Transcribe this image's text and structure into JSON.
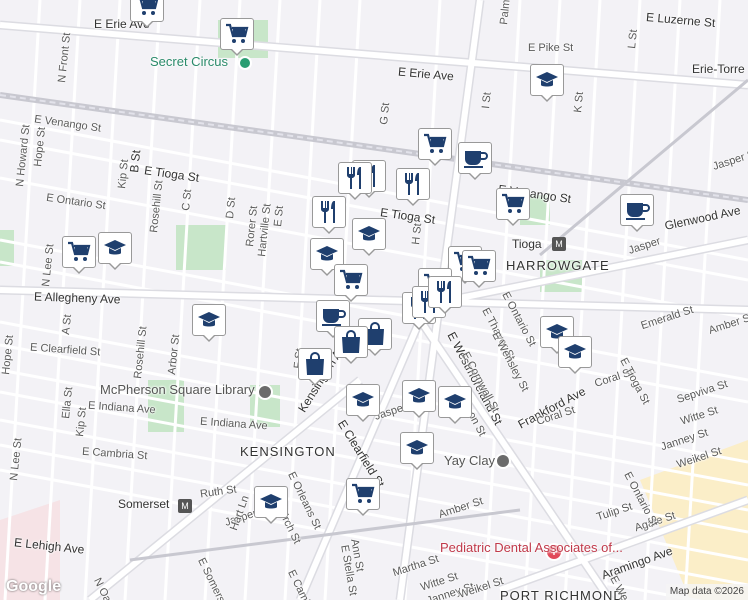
{
  "colors": {
    "background": "#f3f2f6",
    "road": "#ffffff",
    "road_edge": "#dcdce2",
    "park": "#c8e6c9",
    "rail": "#b8b8c0",
    "marker": "#1f3f6e",
    "accent_beige": "#fbeec8"
  },
  "labels": {
    "erie_ave_left": "E Erie Ave",
    "erie_ave_right": "E Erie Ave",
    "luzerne": "E Luzerne St",
    "pike": "E Pike St",
    "erie_torre": "Erie-Torre",
    "palmetto": "Palmetto St",
    "l_st": "L St",
    "k_st": "K St",
    "i_st": "I St",
    "g_st": "G St",
    "e_st_top": "E St",
    "n_front": "N Front St",
    "b_st": "B St",
    "venango_left": "E Venango St",
    "venango_right": "E Venango St",
    "tioga_left": "E Tioga St",
    "tioga_mid": "E Tioga St",
    "tioga_station": "Tioga",
    "ontario_left": "E Ontario St",
    "ontario_right": "E Ontario St",
    "glenwood": "Glenwood Ave",
    "harrowgate": "HARROWGATE",
    "allegheny": "E Allegheny Ave",
    "clearfield_left": "E Clearfield St",
    "clearfield_diag": "E Clearfield St",
    "kensington": "KENSINGTON",
    "kensington_ave": "Kensington Ave",
    "indiana_left": "E Indiana Ave",
    "indiana_mid": "E Indiana Ave",
    "cambria": "E Cambria St",
    "lehigh": "E Lehigh Ave",
    "somerset": "Somerset",
    "mcpherson": "McPherson Square Library",
    "secret_circus": "Secret Circus",
    "yay_clay": "Yay Clay",
    "pediatric": "Pediatric Dental Associates of...",
    "port_richmond": "PORT RICHMOND",
    "frankford": "Frankford Ave",
    "westmoreland": "E Westmoreland St",
    "aramingo": "Aramingo Ave",
    "emerald": "Emerald St",
    "amber_right": "Amber St",
    "amber_bottom": "Amber St",
    "coral_right": "Coral St",
    "coral_mid": "Coral St",
    "jasper_right": "Jasper St",
    "jasper_far": "Jasper",
    "jasper_mid": "Jasper",
    "jasper_bottom": "Jasper St",
    "janney": "Janney St",
    "janney_bottom": "Janney St",
    "weikel": "Weikel St",
    "weikel_bottom": "Weikel St",
    "witte": "Witte St",
    "witte_bottom": "Witte St",
    "sepviva": "Sepviva St",
    "tulip": "Tulip St",
    "agate": "Agate St",
    "martha": "Martha St",
    "ruth": "Ruth St",
    "hart": "Hart Ln",
    "orleans": "E Orleans St",
    "birch": "Birch St",
    "ann": "Ann St",
    "e_stella": "E Stella St",
    "cornwall": "E Cornwall St",
    "thayer": "E Thayer St",
    "wensley": "E Wensley St",
    "ontario_diag": "E Ontario St",
    "tioga_diag": "E Tioga St",
    "ontario_low": "E Ontario St",
    "rorer": "Rorer St",
    "hartville": "Hartville St",
    "d_st": "D St",
    "c_st": "C St",
    "kip_top": "Kip St",
    "kip_mid": "Kip St",
    "rosehill_top": "Rosehill St",
    "rosehill_mid": "Rosehill St",
    "arbor": "Arbor St",
    "ella": "Ella St",
    "a_st": "A St",
    "hope_top": "Hope St",
    "hope_mid": "Hope St",
    "howard": "N Howard St",
    "n_lee_top": "N Lee St",
    "n_lee_bot": "N Lee St",
    "h_st": "H St",
    "f_st": "F St",
    "e_st_mid": "E St",
    "somerset_e": "E Somers",
    "camb_e": "E Camb",
    "oak": "N Oak",
    "on_st": "on St",
    "e_west": "E West",
    "attribution": "Map data ©2026"
  },
  "pins": [
    {
      "name": "shopping-cart-icon",
      "type": "cart"
    },
    {
      "name": "shopping-cart-icon",
      "type": "cart"
    },
    {
      "name": "school-icon",
      "type": "school"
    },
    {
      "name": "shopping-cart-icon",
      "type": "cart"
    },
    {
      "name": "cafe-icon",
      "type": "cafe"
    },
    {
      "name": "restaurant-icon",
      "type": "food"
    },
    {
      "name": "restaurant-icon",
      "type": "food"
    },
    {
      "name": "restaurant-icon",
      "type": "food"
    },
    {
      "name": "restaurant-icon",
      "type": "food"
    },
    {
      "name": "school-icon",
      "type": "school"
    },
    {
      "name": "school-icon",
      "type": "school"
    },
    {
      "name": "shopping-cart-icon",
      "type": "cart"
    },
    {
      "name": "shopping-cart-icon",
      "type": "cart"
    },
    {
      "name": "shopping-cart-icon",
      "type": "cart"
    },
    {
      "name": "cafe-icon",
      "type": "cafe"
    },
    {
      "name": "school-icon",
      "type": "school"
    },
    {
      "name": "shopping-cart-icon",
      "type": "cart"
    },
    {
      "name": "shopping-cart-icon",
      "type": "cart"
    },
    {
      "name": "shopping-cart-icon",
      "type": "cart"
    },
    {
      "name": "restaurant-icon",
      "type": "food"
    },
    {
      "name": "restaurant-icon",
      "type": "food"
    },
    {
      "name": "restaurant-icon",
      "type": "food"
    },
    {
      "name": "cafe-icon",
      "type": "cafe"
    },
    {
      "name": "school-icon",
      "type": "school"
    },
    {
      "name": "school-icon",
      "type": "school"
    },
    {
      "name": "shopping-bag-icon",
      "type": "bag"
    },
    {
      "name": "shopping-bag-icon",
      "type": "bag"
    },
    {
      "name": "shopping-bag-icon",
      "type": "bag"
    },
    {
      "name": "school-icon",
      "type": "school"
    },
    {
      "name": "school-icon",
      "type": "school"
    },
    {
      "name": "school-icon",
      "type": "school"
    },
    {
      "name": "school-icon",
      "type": "school"
    },
    {
      "name": "shopping-cart-icon",
      "type": "cart"
    },
    {
      "name": "school-icon",
      "type": "school"
    }
  ]
}
